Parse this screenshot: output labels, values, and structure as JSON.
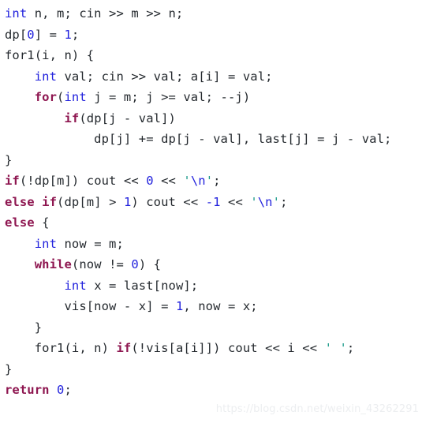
{
  "editor": {
    "language": "cpp",
    "background_color": "#ffffff",
    "colors": {
      "plain": "#24292e",
      "keyword": "#8e1650",
      "type": "#2222dd",
      "number": "#2222dd",
      "string": "#2222dd",
      "quote": "#1a9a8a",
      "watermark": "#eceef0"
    },
    "lines": [
      {
        "index": 1,
        "text": "int n, m; cin >> m >> n;",
        "tokens": [
          {
            "t": "int",
            "k": "type"
          },
          {
            "t": " n, m; cin >> m >> n;",
            "k": "plain"
          }
        ]
      },
      {
        "index": 2,
        "text": "dp[0] = 1;",
        "tokens": [
          {
            "t": "dp[",
            "k": "plain"
          },
          {
            "t": "0",
            "k": "number"
          },
          {
            "t": "] = ",
            "k": "plain"
          },
          {
            "t": "1",
            "k": "number"
          },
          {
            "t": ";",
            "k": "plain"
          }
        ]
      },
      {
        "index": 3,
        "text": "for1(i, n) {",
        "tokens": [
          {
            "t": "for1(i, n) {",
            "k": "plain"
          }
        ]
      },
      {
        "index": 4,
        "text": "    int val; cin >> val; a[i] = val;",
        "tokens": [
          {
            "t": "    ",
            "k": "plain"
          },
          {
            "t": "int",
            "k": "type"
          },
          {
            "t": " val; cin >> val; a[i] = val;",
            "k": "plain"
          }
        ]
      },
      {
        "index": 5,
        "text": "    for(int j = m; j >= val; --j)",
        "tokens": [
          {
            "t": "    ",
            "k": "plain"
          },
          {
            "t": "for",
            "k": "keyword"
          },
          {
            "t": "(",
            "k": "plain"
          },
          {
            "t": "int",
            "k": "type"
          },
          {
            "t": " j = m; j >= val; --j)",
            "k": "plain"
          }
        ]
      },
      {
        "index": 6,
        "text": "        if(dp[j - val])",
        "tokens": [
          {
            "t": "        ",
            "k": "plain"
          },
          {
            "t": "if",
            "k": "keyword"
          },
          {
            "t": "(dp[j - val])",
            "k": "plain"
          }
        ]
      },
      {
        "index": 7,
        "text": "            dp[j] += dp[j - val], last[j] = j - val;",
        "tokens": [
          {
            "t": "            dp[j] += dp[j - val], last[j] = j - val;",
            "k": "plain"
          }
        ]
      },
      {
        "index": 8,
        "text": "}",
        "tokens": [
          {
            "t": "}",
            "k": "plain"
          }
        ]
      },
      {
        "index": 9,
        "text": "if(!dp[m]) cout << 0 << '\\n';",
        "tokens": [
          {
            "t": "if",
            "k": "keyword"
          },
          {
            "t": "(!dp[m]) cout << ",
            "k": "plain"
          },
          {
            "t": "0",
            "k": "number"
          },
          {
            "t": " << ",
            "k": "plain"
          },
          {
            "t": "'",
            "k": "quote"
          },
          {
            "t": "\\n",
            "k": "string"
          },
          {
            "t": "'",
            "k": "quote"
          },
          {
            "t": ";",
            "k": "plain"
          }
        ]
      },
      {
        "index": 10,
        "text": "else if(dp[m] > 1) cout << -1 << '\\n';",
        "tokens": [
          {
            "t": "else",
            "k": "keyword"
          },
          {
            "t": " ",
            "k": "plain"
          },
          {
            "t": "if",
            "k": "keyword"
          },
          {
            "t": "(dp[m] > ",
            "k": "plain"
          },
          {
            "t": "1",
            "k": "number"
          },
          {
            "t": ") cout << ",
            "k": "plain"
          },
          {
            "t": "-1",
            "k": "number"
          },
          {
            "t": " << ",
            "k": "plain"
          },
          {
            "t": "'",
            "k": "quote"
          },
          {
            "t": "\\n",
            "k": "string"
          },
          {
            "t": "'",
            "k": "quote"
          },
          {
            "t": ";",
            "k": "plain"
          }
        ]
      },
      {
        "index": 11,
        "text": "else {",
        "tokens": [
          {
            "t": "else",
            "k": "keyword"
          },
          {
            "t": " {",
            "k": "plain"
          }
        ]
      },
      {
        "index": 12,
        "text": "    int now = m;",
        "tokens": [
          {
            "t": "    ",
            "k": "plain"
          },
          {
            "t": "int",
            "k": "type"
          },
          {
            "t": " now = m;",
            "k": "plain"
          }
        ]
      },
      {
        "index": 13,
        "text": "    while(now != 0) {",
        "tokens": [
          {
            "t": "    ",
            "k": "plain"
          },
          {
            "t": "while",
            "k": "keyword"
          },
          {
            "t": "(now != ",
            "k": "plain"
          },
          {
            "t": "0",
            "k": "number"
          },
          {
            "t": ") {",
            "k": "plain"
          }
        ]
      },
      {
        "index": 14,
        "text": "        int x = last[now];",
        "tokens": [
          {
            "t": "        ",
            "k": "plain"
          },
          {
            "t": "int",
            "k": "type"
          },
          {
            "t": " x = last[now];",
            "k": "plain"
          }
        ]
      },
      {
        "index": 15,
        "text": "        vis[now - x] = 1, now = x;",
        "tokens": [
          {
            "t": "        vis[now - x] = ",
            "k": "plain"
          },
          {
            "t": "1",
            "k": "number"
          },
          {
            "t": ", now = x;",
            "k": "plain"
          }
        ]
      },
      {
        "index": 16,
        "text": "    }",
        "tokens": [
          {
            "t": "    }",
            "k": "plain"
          }
        ]
      },
      {
        "index": 17,
        "text": "    for1(i, n) if(!vis[a[i]]) cout << i << ' ';",
        "tokens": [
          {
            "t": "    for1(i, n) ",
            "k": "plain"
          },
          {
            "t": "if",
            "k": "keyword"
          },
          {
            "t": "(!vis[a[i]]) cout << i << ",
            "k": "plain"
          },
          {
            "t": "'",
            "k": "quote"
          },
          {
            "t": " ",
            "k": "string"
          },
          {
            "t": "'",
            "k": "quote"
          },
          {
            "t": ";",
            "k": "plain"
          }
        ]
      },
      {
        "index": 18,
        "text": "}",
        "tokens": [
          {
            "t": "}",
            "k": "plain"
          }
        ]
      },
      {
        "index": 19,
        "text": "return 0;",
        "tokens": [
          {
            "t": "return",
            "k": "keyword"
          },
          {
            "t": " ",
            "k": "plain"
          },
          {
            "t": "0",
            "k": "number"
          },
          {
            "t": ";",
            "k": "plain"
          }
        ]
      }
    ]
  },
  "watermark": {
    "text": "https://blog.csdn.net/weixin_43262291"
  }
}
